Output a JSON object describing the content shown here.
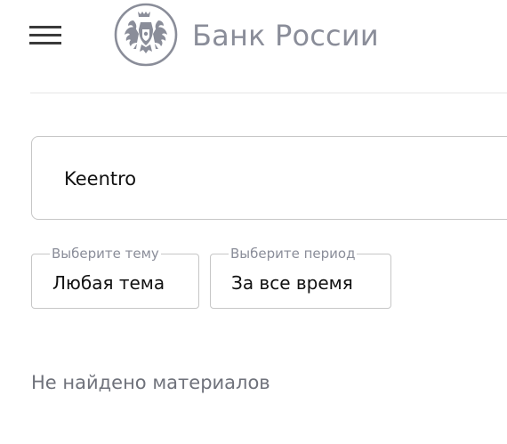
{
  "header": {
    "menu_icon": "hamburger-menu-icon",
    "logo_icon": "double-headed-eagle-icon",
    "logo_text": "Банк России",
    "logo_color": "#8a8d99"
  },
  "search": {
    "value": "Keentro",
    "placeholder": ""
  },
  "filters": {
    "topic": {
      "legend": "Выберите тему",
      "value": "Любая тема"
    },
    "period": {
      "legend": "Выберите период",
      "value": "За все время"
    }
  },
  "results": {
    "empty_message": "Не найдено материалов"
  },
  "colors": {
    "border": "#c6c6c6",
    "muted_text": "#8a8d99",
    "body_text": "#111111"
  }
}
